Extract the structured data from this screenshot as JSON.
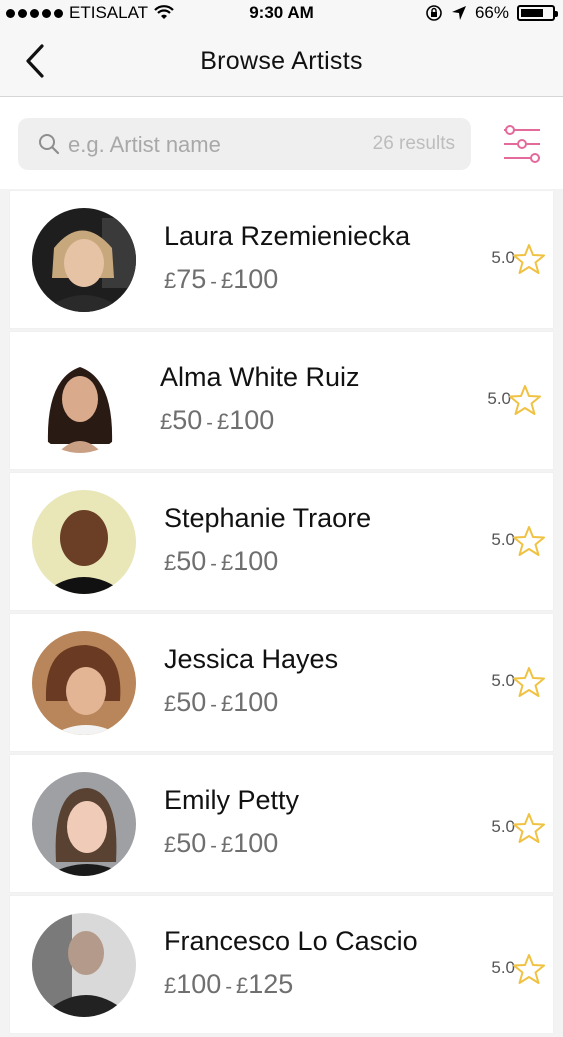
{
  "status_bar": {
    "carrier": "ETISALAT",
    "time": "9:30 AM",
    "battery": "66%",
    "battery_level": 0.66
  },
  "nav": {
    "title": "Browse Artists",
    "back_icon": "chevron-left-icon"
  },
  "search": {
    "placeholder": "e.g. Artist name",
    "results": "26 results",
    "search_icon": "search-icon",
    "filter_icon": "sliders-icon"
  },
  "colors": {
    "accent_pink": "#e46a9b",
    "star_gold": "#f0c243",
    "price_gray": "#6f6f6f"
  },
  "artists": [
    {
      "name": "Laura Rzemieniecka",
      "price_min": "75",
      "price_max": "100",
      "currency": "£",
      "rating": "5.0"
    },
    {
      "name": "Alma White Ruiz",
      "price_min": "50",
      "price_max": "100",
      "currency": "£",
      "rating": "5.0"
    },
    {
      "name": "Stephanie Traore",
      "price_min": "50",
      "price_max": "100",
      "currency": "£",
      "rating": "5.0"
    },
    {
      "name": "Jessica Hayes",
      "price_min": "50",
      "price_max": "100",
      "currency": "£",
      "rating": "5.0"
    },
    {
      "name": "Emily Petty",
      "price_min": "50",
      "price_max": "100",
      "currency": "£",
      "rating": "5.0"
    },
    {
      "name": "Francesco Lo Cascio",
      "price_min": "100",
      "price_max": "125",
      "currency": "£",
      "rating": "5.0"
    }
  ]
}
